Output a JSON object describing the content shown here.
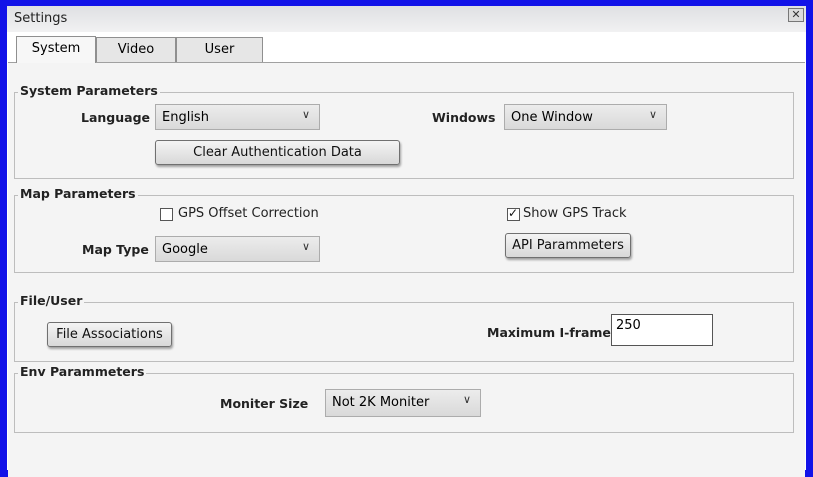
{
  "window": {
    "title": "Settings",
    "close_glyph": "✕"
  },
  "tabs": [
    {
      "label": "System",
      "active": true
    },
    {
      "label": "Video",
      "active": false
    },
    {
      "label": "User",
      "active": false
    }
  ],
  "system_parameters": {
    "legend": "System Parameters",
    "language_label": "Language",
    "language_value": "English",
    "windows_label": "Windows",
    "windows_value": "One Window",
    "clear_button": "Clear Authentication Data"
  },
  "map_parameters": {
    "legend": "Map Parameters",
    "gps_offset_label": "GPS Offset Correction",
    "gps_offset_checked": false,
    "show_gps_label": "Show GPS Track",
    "show_gps_checked": true,
    "map_type_label": "Map Type",
    "map_type_value": "Google",
    "api_button": "API Parammeters"
  },
  "file_user": {
    "legend": "File/User",
    "file_assoc_button": "File Associations",
    "max_iframe_label": "Maximum I-frame",
    "max_iframe_value": "250"
  },
  "env_parameters": {
    "legend": "Env Parammeters",
    "monitor_label": "Moniter Size",
    "monitor_value": "Not 2K Moniter"
  },
  "icons": {
    "dropdown": "chevron-down-icon",
    "check": "checkmark-icon",
    "close": "close-icon"
  },
  "colors": {
    "window_border": "#1212e8",
    "panel_bg": "#f4f4f4"
  }
}
